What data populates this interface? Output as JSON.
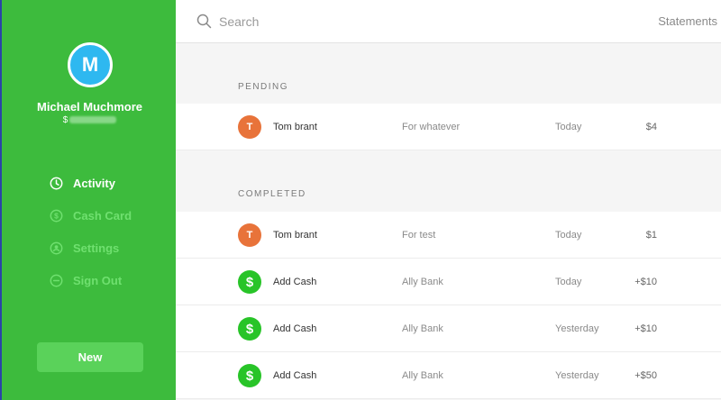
{
  "sidebar": {
    "avatar_letter": "M",
    "name": "Michael Muchmore",
    "cashtag_prefix": "$",
    "nav": [
      {
        "label": "Activity",
        "active": true,
        "icon": "clock-icon"
      },
      {
        "label": "Cash Card",
        "active": false,
        "icon": "dollar-circle-icon"
      },
      {
        "label": "Settings",
        "active": false,
        "icon": "user-circle-icon"
      },
      {
        "label": "Sign Out",
        "active": false,
        "icon": "minus-circle-icon"
      }
    ],
    "new_label": "New"
  },
  "topbar": {
    "search_placeholder": "Search",
    "statements_label": "Statements"
  },
  "pending": {
    "label": "PENDING",
    "rows": [
      {
        "avatar": "T",
        "name": "Tom brant",
        "note": "For whatever",
        "date": "Today",
        "amount": "$4"
      }
    ]
  },
  "completed": {
    "label": "COMPLETED",
    "rows": [
      {
        "avatar": "T",
        "name": "Tom brant",
        "note": "For test",
        "date": "Today",
        "amount": "$1"
      },
      {
        "avatar": "$",
        "name": "Add Cash",
        "note": "Ally Bank",
        "date": "Today",
        "amount": "+$10"
      },
      {
        "avatar": "$",
        "name": "Add Cash",
        "note": "Ally Bank",
        "date": "Yesterday",
        "amount": "+$10"
      },
      {
        "avatar": "$",
        "name": "Add Cash",
        "note": "Ally Bank",
        "date": "Yesterday",
        "amount": "+$50"
      }
    ]
  },
  "colors": {
    "sidebar_green": "#3dbb3d",
    "avatar_blue": "#2eb8f0",
    "contact_orange": "#e8733a",
    "cash_green": "#28c428"
  }
}
